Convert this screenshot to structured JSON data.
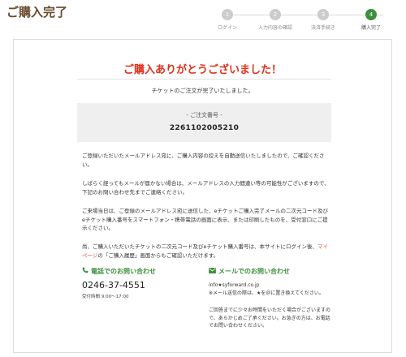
{
  "header": {
    "title": "ご購入完了"
  },
  "steps": [
    {
      "num": "1",
      "label": "ログイン",
      "active": false
    },
    {
      "num": "2",
      "label": "入力内容の確認",
      "active": false
    },
    {
      "num": "3",
      "label": "決済手続き",
      "active": false
    },
    {
      "num": "4",
      "label": "購入完了",
      "active": true
    }
  ],
  "main": {
    "thanks_heading": "ご購入ありがとうございました！",
    "order_complete_msg": "チケットのご注文が完了いたしました。",
    "order_number_label": "- ご注文番号 -",
    "order_number": "2261102005210",
    "para1": "ご登録いただいたメールアドレス宛に、ご購入内容の控えを自動送信いたしましたので、ご確認ください。",
    "para2": "しばらく経ってもメールが届かない場合は、メールアドレスの入力間違い等の可能性がございますので、下記のお問い合わせ先までご連絡ください。",
    "para3": "ご来場当日は、ご登録のメールアドレス宛に送信した、eチケットご購入完了メールの二次元コード及びeチケット購入番号をスマートフォン・携帯電話の画面に表示、または印刷したものを、受付窓口にご提示ください。",
    "para4_before": "尚、ご購入いただいたチケットの二次元コード及びeチケット購入番号は、本サイトにログイン後、",
    "para4_link": "マイページ",
    "para4_after": "の「ご購入履歴」画面からもご確認いただけます。"
  },
  "contact": {
    "phone_title": "電話でのお問い合わせ",
    "phone_number": "0246-37-4551",
    "phone_hours": "受付時間 9:00～17:00",
    "mail_title": "メールでのお問い合わせ",
    "mail_address": "info★syforward.co.jp",
    "mail_note1": "※メール送信の際は、★を＠に置き換えてください。",
    "mail_note2": "ご回答までに少々お時間をいただく場合がございますので、あらかじめご了承ください。お急ぎの方は、お電話でお問い合わせください。"
  },
  "colors": {
    "accent_green": "#3d8f3d",
    "heading_red": "#e02f1b",
    "title_brown": "#6b4a2b"
  },
  "icons": {
    "phone": "phone-icon",
    "mail": "mail-icon"
  }
}
